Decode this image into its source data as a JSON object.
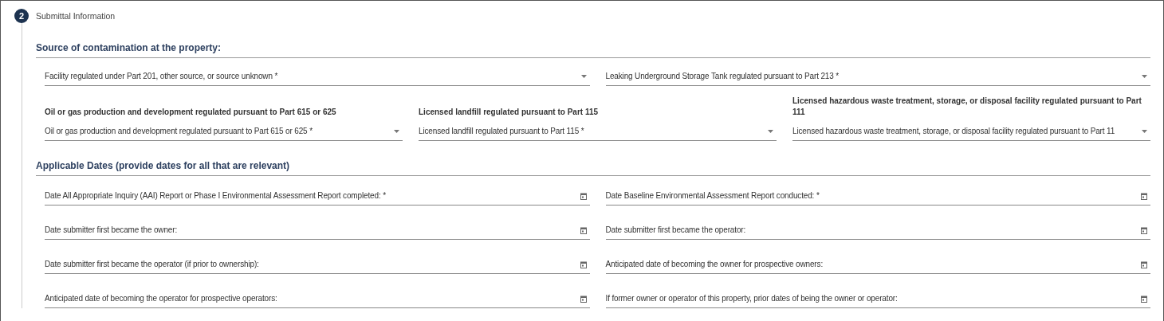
{
  "step": {
    "number": "2",
    "title": "Submittal Information"
  },
  "sections": [
    {
      "heading": "Source of contamination at the property:",
      "rows": [
        {
          "fields": [
            {
              "kind": "select",
              "placeholder": "Facility regulated under Part 201, other source, or source unknown *"
            },
            {
              "kind": "select",
              "placeholder": "Leaking Underground Storage Tank regulated pursuant to Part 213 *"
            }
          ]
        },
        {
          "fields": [
            {
              "kind": "select",
              "label": "Oil or gas production and development regulated pursuant to Part 615 or 625",
              "placeholder": "Oil or gas production and development regulated pursuant to Part 615 or 625 *"
            },
            {
              "kind": "select",
              "label": "Licensed landfill regulated pursuant to Part 115",
              "placeholder": "Licensed landfill regulated pursuant to Part 115 *"
            },
            {
              "kind": "select",
              "label": "Licensed hazardous waste treatment, storage, or disposal facility regulated pursuant to Part 111",
              "placeholder": "Licensed hazardous waste treatment, storage, or disposal facility regulated pursuant to Part 11"
            }
          ]
        }
      ]
    },
    {
      "heading": "Applicable Dates (provide dates for all that are relevant)",
      "rows": [
        {
          "fields": [
            {
              "kind": "date",
              "placeholder": "Date All Appropriate Inquiry (AAI) Report or Phase I Environmental Assessment Report completed: *"
            },
            {
              "kind": "date",
              "placeholder": "Date Baseline Environmental Assessment Report conducted: *"
            }
          ]
        },
        {
          "fields": [
            {
              "kind": "date",
              "placeholder": "Date submitter first became the owner:"
            },
            {
              "kind": "date",
              "placeholder": "Date submitter first became the operator:"
            }
          ]
        },
        {
          "fields": [
            {
              "kind": "date",
              "placeholder": "Date submitter first became the operator (if prior to ownership):"
            },
            {
              "kind": "date",
              "placeholder": "Anticipated date of becoming the owner for prospective owners:"
            }
          ]
        },
        {
          "fields": [
            {
              "kind": "date",
              "placeholder": "Anticipated date of becoming the operator for prospective operators:"
            },
            {
              "kind": "date",
              "placeholder": "If former owner or operator of this property, prior dates of being the owner or operator:"
            }
          ]
        }
      ]
    }
  ]
}
